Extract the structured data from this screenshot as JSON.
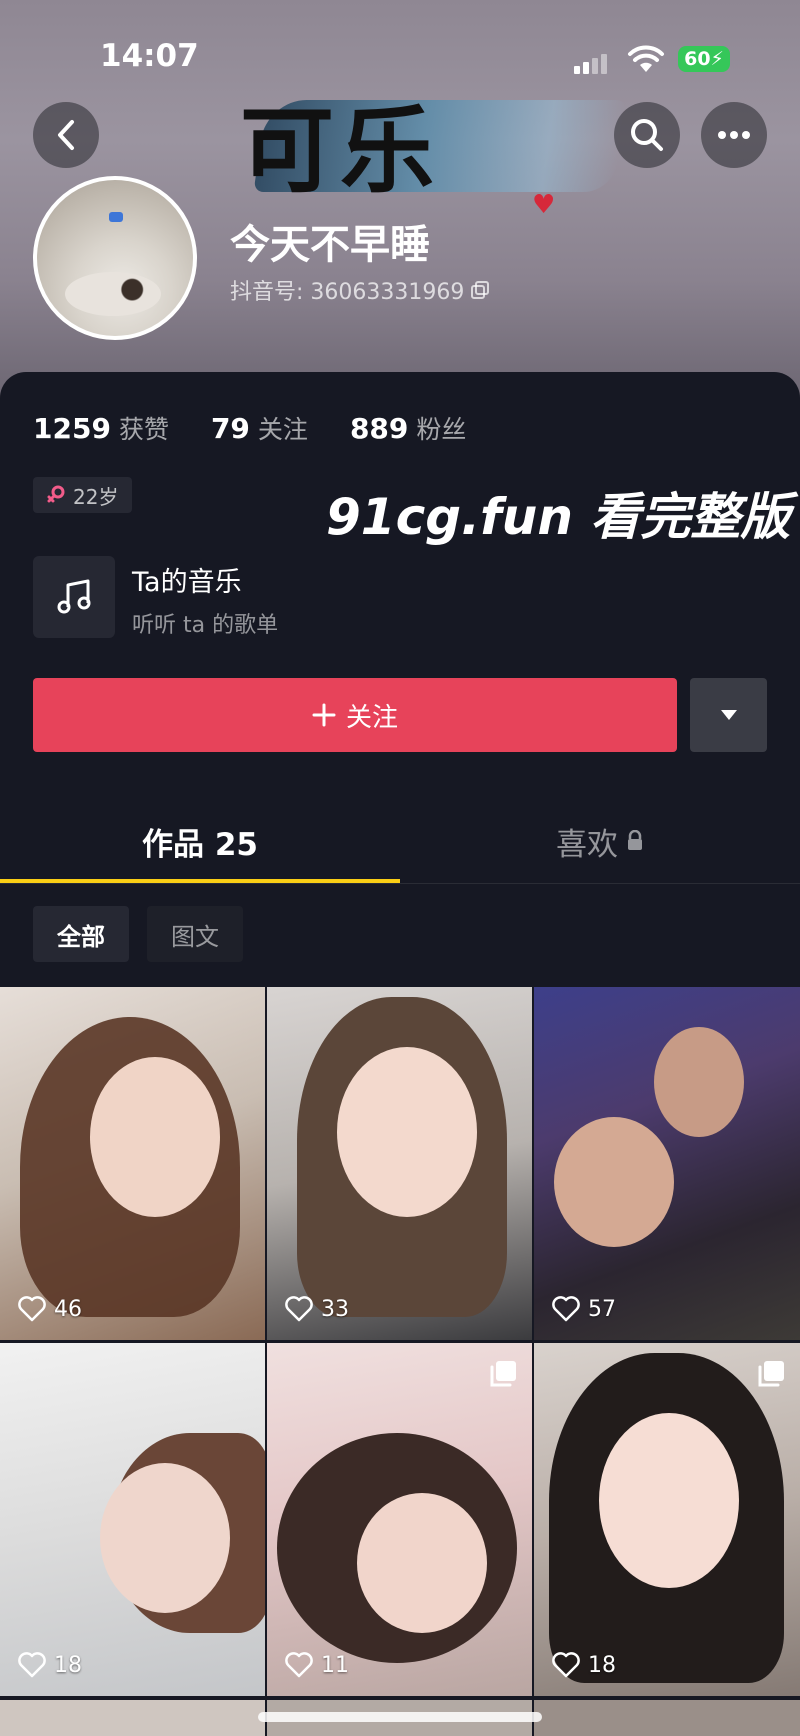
{
  "status_bar": {
    "time": "14:07",
    "battery": "60"
  },
  "header": {
    "banner_text": "可乐",
    "nickname": "今天不早睡",
    "douyin_id": "抖音号: 36063331969"
  },
  "stats": [
    {
      "value": "1259",
      "label": "获赞"
    },
    {
      "value": "79",
      "label": "关注"
    },
    {
      "value": "889",
      "label": "粉丝"
    }
  ],
  "age_badge": "22岁",
  "watermark": "91cg.fun 看完整版",
  "music": {
    "title": "Ta的音乐",
    "subtitle": "听听 ta 的歌单"
  },
  "follow_button": "关注",
  "tabs": {
    "works": "作品 25",
    "likes": "喜欢"
  },
  "filters": {
    "all": "全部",
    "image_text": "图文"
  },
  "grid": [
    {
      "likes": "46",
      "multi": false
    },
    {
      "likes": "33",
      "multi": false
    },
    {
      "likes": "57",
      "multi": false
    },
    {
      "likes": "18",
      "multi": false
    },
    {
      "likes": "11",
      "multi": true
    },
    {
      "likes": "18",
      "multi": true
    }
  ],
  "colors": {
    "accent": "#e7435a",
    "tab_underline": "#face15",
    "panel": "#161823"
  }
}
